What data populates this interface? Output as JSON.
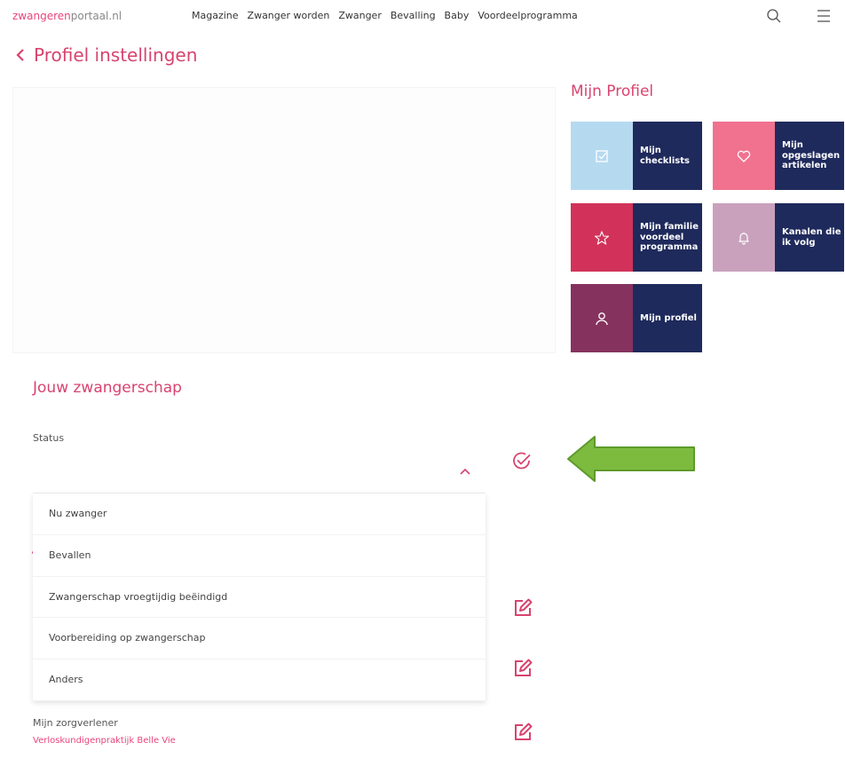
{
  "header": {
    "logo_part1": "zwangeren",
    "logo_part2": "portaal.nl",
    "nav": [
      "Magazine",
      "Zwanger worden",
      "Zwanger",
      "Bevalling",
      "Baby",
      "Voordeelprogramma"
    ]
  },
  "page": {
    "title": "Profiel instellingen"
  },
  "pregnancy": {
    "section_title": "Jouw zwangerschap",
    "status_label": "Status",
    "status_value": "",
    "options": [
      "Nu zwanger",
      "Bevallen",
      "Zwangerschap vroegtijdig beëindigd",
      "Voorbereiding op zwangerschap",
      "Anders"
    ],
    "care_label": "Mijn zorgverlener",
    "care_value": "Verloskundigenpraktijk Belle Vie"
  },
  "profile": {
    "title": "Mijn Profiel",
    "tiles": [
      {
        "label": "Mijn checklists",
        "icon": "checklist-icon",
        "color": "#b5daf0"
      },
      {
        "label": "Mijn opgeslagen artikelen",
        "icon": "heart-icon",
        "color": "#f0728f"
      },
      {
        "label": "Mijn familie voordeel programma",
        "icon": "star-icon",
        "color": "#d2325a"
      },
      {
        "label": "Kanalen die ik volg",
        "icon": "bell-icon",
        "color": "#c9a1bd"
      },
      {
        "label": "Mijn profiel",
        "icon": "user-icon",
        "color": "#86325e"
      }
    ]
  },
  "colors": {
    "accent": "#d8436f",
    "navy": "#1f2a5c",
    "arrow": "#7dbb3f"
  }
}
